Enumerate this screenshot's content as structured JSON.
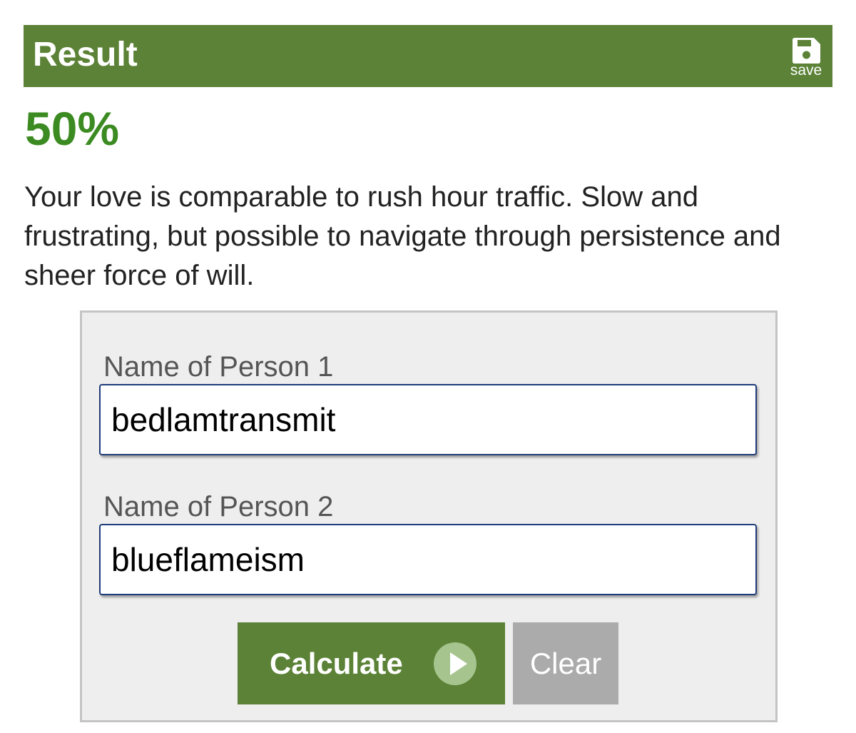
{
  "result_header": {
    "title": "Result",
    "save_label": "save",
    "save_icon": "floppy-disk-icon",
    "background_color": "#5b8236"
  },
  "result": {
    "percentage": "50%",
    "percentage_color": "#3c8b22",
    "description": "Your love is comparable to rush hour traffic. Slow and frustrating, but possible to navigate through persistence and sheer force of will."
  },
  "form": {
    "person1": {
      "label": "Name of Person 1",
      "value": "bedlamtransmit"
    },
    "person2": {
      "label": "Name of Person 2",
      "value": "blueflameism"
    },
    "calculate_label": "Calculate",
    "calculate_icon": "play-circle-icon",
    "clear_label": "Clear"
  }
}
